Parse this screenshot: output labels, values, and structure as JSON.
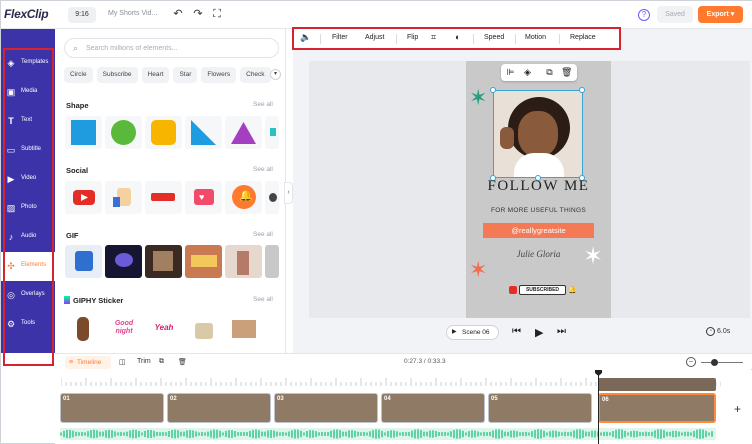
{
  "app": {
    "logo": "FlexClip",
    "aspect_ratio": "9:16",
    "project_name": "My Shorts Vid...",
    "saved_label": "Saved",
    "export_label": "Export",
    "accent": "#ff7a2f",
    "sidebar_color": "#3d33a8"
  },
  "sidebar": {
    "items": [
      {
        "label": "Templates",
        "icon": "templates-icon",
        "glyph": "◈"
      },
      {
        "label": "Media",
        "icon": "media-icon",
        "glyph": "▣"
      },
      {
        "label": "Text",
        "icon": "text-icon",
        "glyph": "T"
      },
      {
        "label": "Subtitle",
        "icon": "subtitle-icon",
        "glyph": "▭"
      },
      {
        "label": "Video",
        "icon": "video-icon",
        "glyph": "▶"
      },
      {
        "label": "Photo",
        "icon": "photo-icon",
        "glyph": "▨"
      },
      {
        "label": "Audio",
        "icon": "audio-icon",
        "glyph": "♪"
      },
      {
        "label": "Elements",
        "icon": "elements-icon",
        "glyph": "✣",
        "active": true
      },
      {
        "label": "Overlays",
        "icon": "overlays-icon",
        "glyph": "◎"
      },
      {
        "label": "Tools",
        "icon": "tools-icon",
        "glyph": "⚙"
      }
    ]
  },
  "panel": {
    "search_placeholder": "Search millions of elements...",
    "chips": [
      "Circle",
      "Subscribe",
      "Heart",
      "Star",
      "Flowers",
      "Check"
    ],
    "sections": [
      {
        "title": "Shape",
        "see_all": "See all"
      },
      {
        "title": "Social",
        "see_all": "See all"
      },
      {
        "title": "GIF",
        "see_all": "See all"
      },
      {
        "title": "GIPHY Sticker",
        "see_all": "See all"
      }
    ],
    "sticker_text": [
      "Good night",
      "Yeah"
    ]
  },
  "editbar": {
    "filter": "Filter",
    "adjust": "Adjust",
    "flip": "Flip",
    "speed": "Speed",
    "motion": "Motion",
    "replace": "Replace"
  },
  "canvas": {
    "title": "FOLLOW ME",
    "subtitle": "FOR MORE USEFUL THINGS",
    "handle": "@reallygreatsite",
    "signature": "Julie Gloria",
    "subscribed": "SUBSCRIBED",
    "scene_label": "Scene 06",
    "duration": "6.0s"
  },
  "timeline": {
    "tab_label": "Timeline",
    "trim_label": "Trim",
    "time": "0:27.3 / 0:33.3",
    "clips": [
      "01",
      "02",
      "03",
      "04",
      "05",
      "06"
    ],
    "zoom_level": 0.35
  }
}
